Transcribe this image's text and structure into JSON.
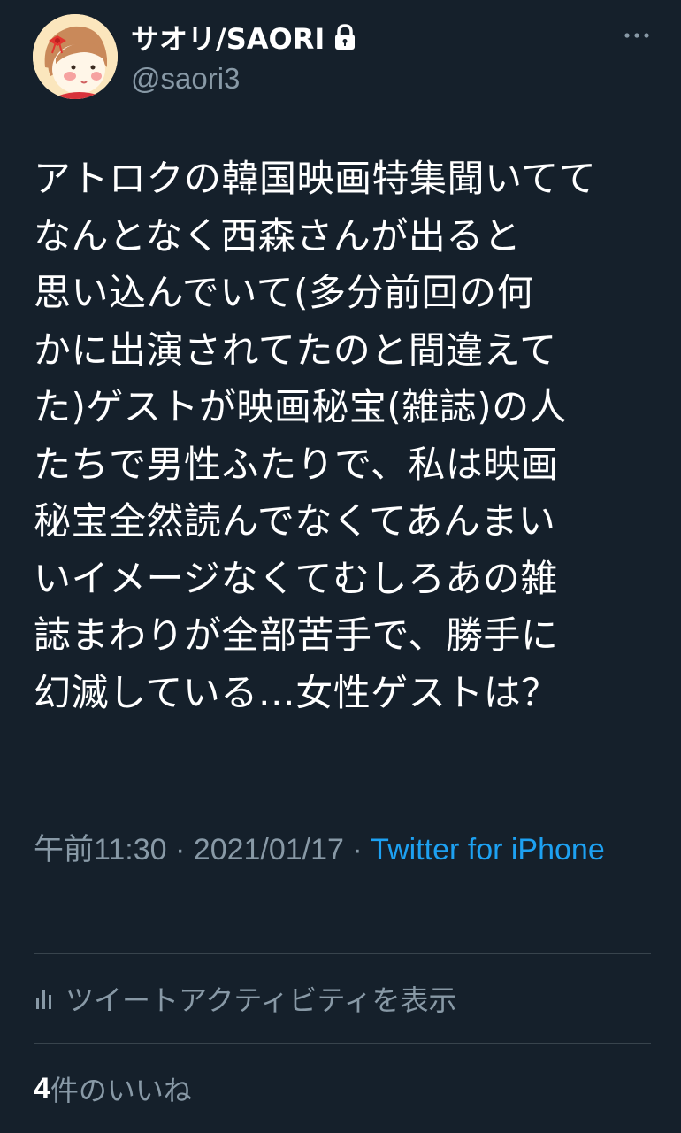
{
  "author": {
    "display_name": "サオリ/SAORI",
    "handle": "@saori3",
    "protected_icon": "lock-icon",
    "avatar_icon": "girl-with-bow-avatar"
  },
  "tweet": {
    "text": "アトロクの韓国映画特集聞いてて\nなんとなく西森さんが出ると\n思い込んでいて(多分前回の何\nかに出演されてたのと間違えて\nた)ゲストが映画秘宝(雑誌)の人\nたちで男性ふたりで、私は映画\n秘宝全然読んでなくてあんまい\nいイメージなくてむしろあの雑\n誌まわりが全部苦手で、勝手に\n幻滅している…女性ゲストは？",
    "time": "午前11:30",
    "separator": " · ",
    "date": "2021/01/17",
    "source": "Twitter for iPhone"
  },
  "actions": {
    "activity_label": "ツイートアクティビティを表示",
    "activity_icon": "bar-chart-icon",
    "likes_count": "4",
    "likes_label": "件のいいね",
    "more_icon": "more-horizontal-icon"
  },
  "colors": {
    "background": "#15202b",
    "text_primary": "#ffffff",
    "text_secondary": "#8899a6",
    "link": "#1da1f2",
    "divider": "#38444d"
  }
}
